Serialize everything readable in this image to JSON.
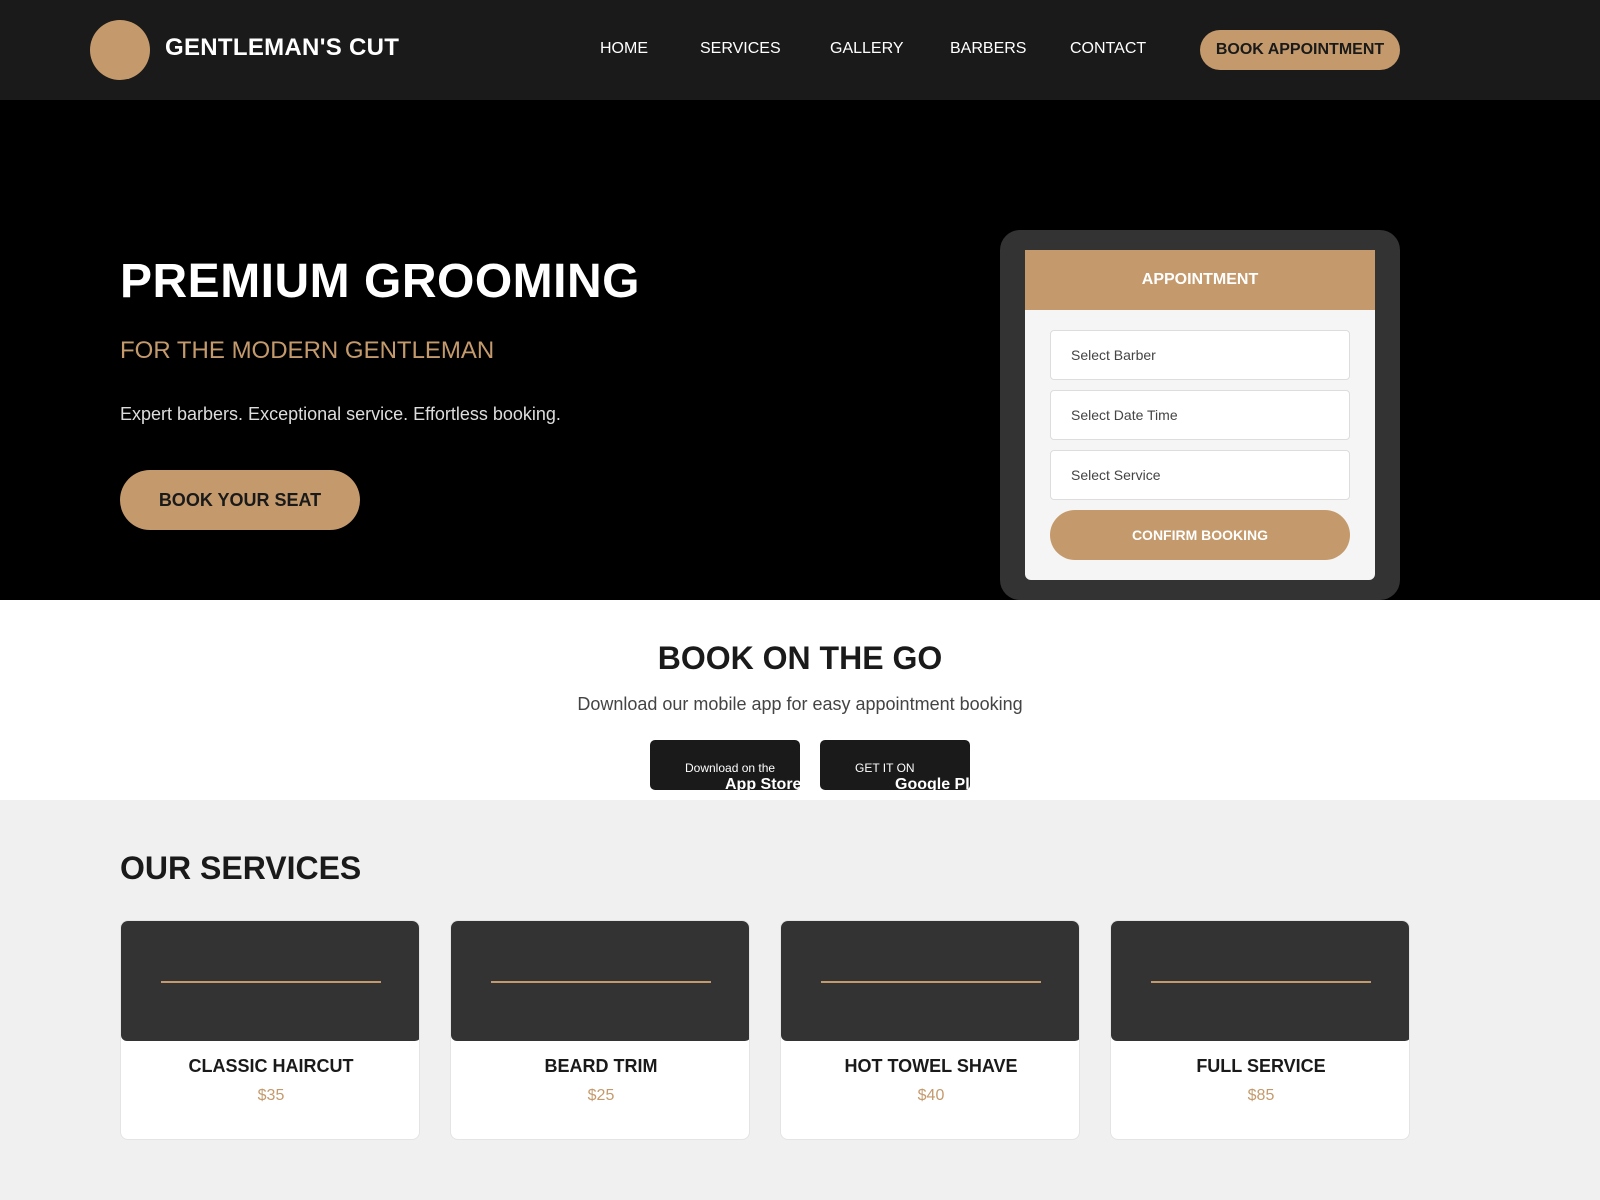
{
  "header": {
    "brand": "GENTLEMAN'S CUT",
    "nav": [
      "HOME",
      "SERVICES",
      "GALLERY",
      "BARBERS",
      "CONTACT"
    ],
    "cta": "BOOK APPOINTMENT"
  },
  "hero": {
    "title": "PREMIUM GROOMING",
    "subtitle": "FOR THE MODERN GENTLEMAN",
    "text": "Expert barbers. Exceptional service. Effortless booking.",
    "cta": "BOOK YOUR SEAT"
  },
  "appointment": {
    "title": "APPOINTMENT",
    "fields": [
      "Select Barber",
      "Select Date Time",
      "Select Service"
    ],
    "confirm": "CONFIRM BOOKING"
  },
  "app": {
    "title": "BOOK ON THE GO",
    "text": "Download our mobile app for easy appointment booking",
    "app_store": {
      "small": "Download on the",
      "big": "App Store"
    },
    "google_play": {
      "small": "GET IT ON",
      "big": "Google Play"
    }
  },
  "services": {
    "title": "OUR SERVICES",
    "items": [
      {
        "name": "CLASSIC HAIRCUT",
        "price": "$35"
      },
      {
        "name": "BEARD TRIM",
        "price": "$25"
      },
      {
        "name": "HOT TOWEL SHAVE",
        "price": "$40"
      },
      {
        "name": "FULL SERVICE",
        "price": "$85"
      }
    ]
  },
  "colors": {
    "accent": "#c49a6c",
    "dark": "#1a1a1a",
    "hero_bg": "#000000",
    "device": "#333333"
  }
}
